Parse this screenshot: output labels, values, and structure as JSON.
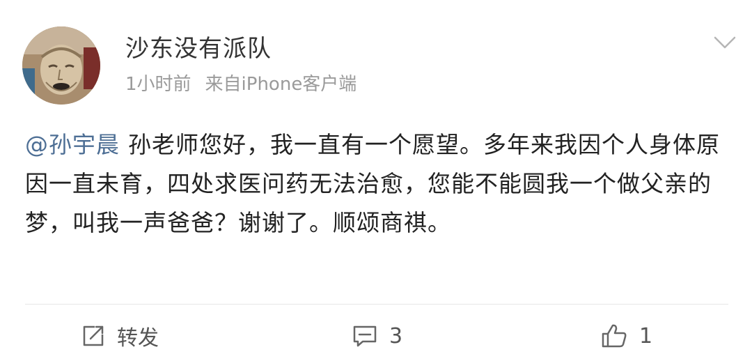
{
  "post": {
    "username": "沙东没有派队",
    "time": "1小时前",
    "source": "来自iPhone客户端",
    "mention": "@孙宇晨",
    "body": "孙老师您好，我一直有一个愿望。多年来我因个人身体原因一直未育，四处求医问药无法治愈，您能不能圆我一个做父亲的梦，叫我一声爸爸？谢谢了。顺颂商祺。"
  },
  "actions": {
    "repost_label": "转发",
    "comment_count": "3",
    "like_count": "1"
  },
  "icons": {
    "menu": "chevron-down-icon",
    "repost": "repost-icon",
    "comment": "comment-icon",
    "like": "thumbs-up-icon"
  },
  "colors": {
    "mention": "#4e6f95",
    "meta": "#9a9a9a",
    "text": "#222222",
    "divider": "#e6e6e6"
  }
}
